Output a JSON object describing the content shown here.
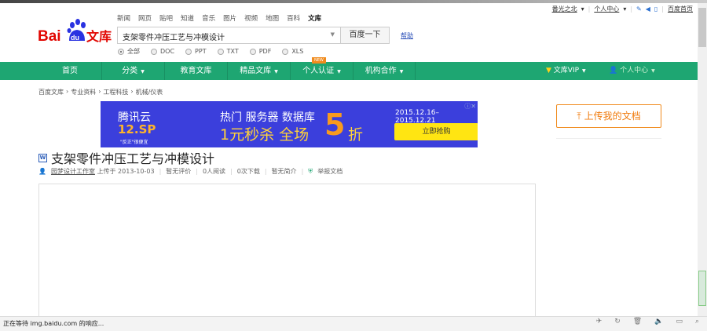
{
  "topbar": {
    "user": "番光之北",
    "user_center": "个人中心",
    "home": "百度首页"
  },
  "logo": {
    "text_bai": "Bai",
    "text_du": "du",
    "text_wenku": "文库"
  },
  "toplinks": [
    "新闻",
    "网页",
    "贴吧",
    "知道",
    "音乐",
    "图片",
    "视频",
    "地图",
    "百科",
    "文库"
  ],
  "search": {
    "value": "支架零件冲压工艺与冲模设计",
    "button": "百度一下",
    "help": "帮助"
  },
  "filters": [
    {
      "label": "全部",
      "checked": true
    },
    {
      "label": "DOC",
      "checked": false
    },
    {
      "label": "PPT",
      "checked": false
    },
    {
      "label": "TXT",
      "checked": false
    },
    {
      "label": "PDF",
      "checked": false
    },
    {
      "label": "XLS",
      "checked": false
    }
  ],
  "nav": {
    "items": [
      {
        "label": "首页"
      },
      {
        "label": "分类",
        "caret": true
      },
      {
        "label": "教育文库"
      },
      {
        "label": "精品文库",
        "caret": true
      },
      {
        "label": "个人认证",
        "caret": true
      },
      {
        "label": "机构合作",
        "caret": true
      }
    ],
    "badge": "NEW",
    "vip": "文库VIP",
    "user_center": "个人中心",
    "color": "#1ea672"
  },
  "breadcrumb": [
    "百度文库",
    "专业资料",
    "工程科技",
    "机械/仪表"
  ],
  "ad": {
    "brand": "腾讯云",
    "sale": "12.SP",
    "tagline": "\"反正\"很便宜",
    "line1": "热门 服务器 数据库",
    "line2": "1元秒杀 全场",
    "five": "5",
    "zhe": "折",
    "dates": "2015.12.16–2015.12.21",
    "cta": "立即抢购"
  },
  "upload": "上传我的文档",
  "doc": {
    "title": "支架零件冲压工艺与冲模设计",
    "author": "园梦设计工作室",
    "uploaded": "上传于 2013-10-03",
    "rating": "暂无评价",
    "reads": "0人阅读",
    "downloads": "0次下载",
    "summary": "暂无简介",
    "report": "举报文档"
  },
  "status": "正在等待 img.baidu.com 的响应..."
}
